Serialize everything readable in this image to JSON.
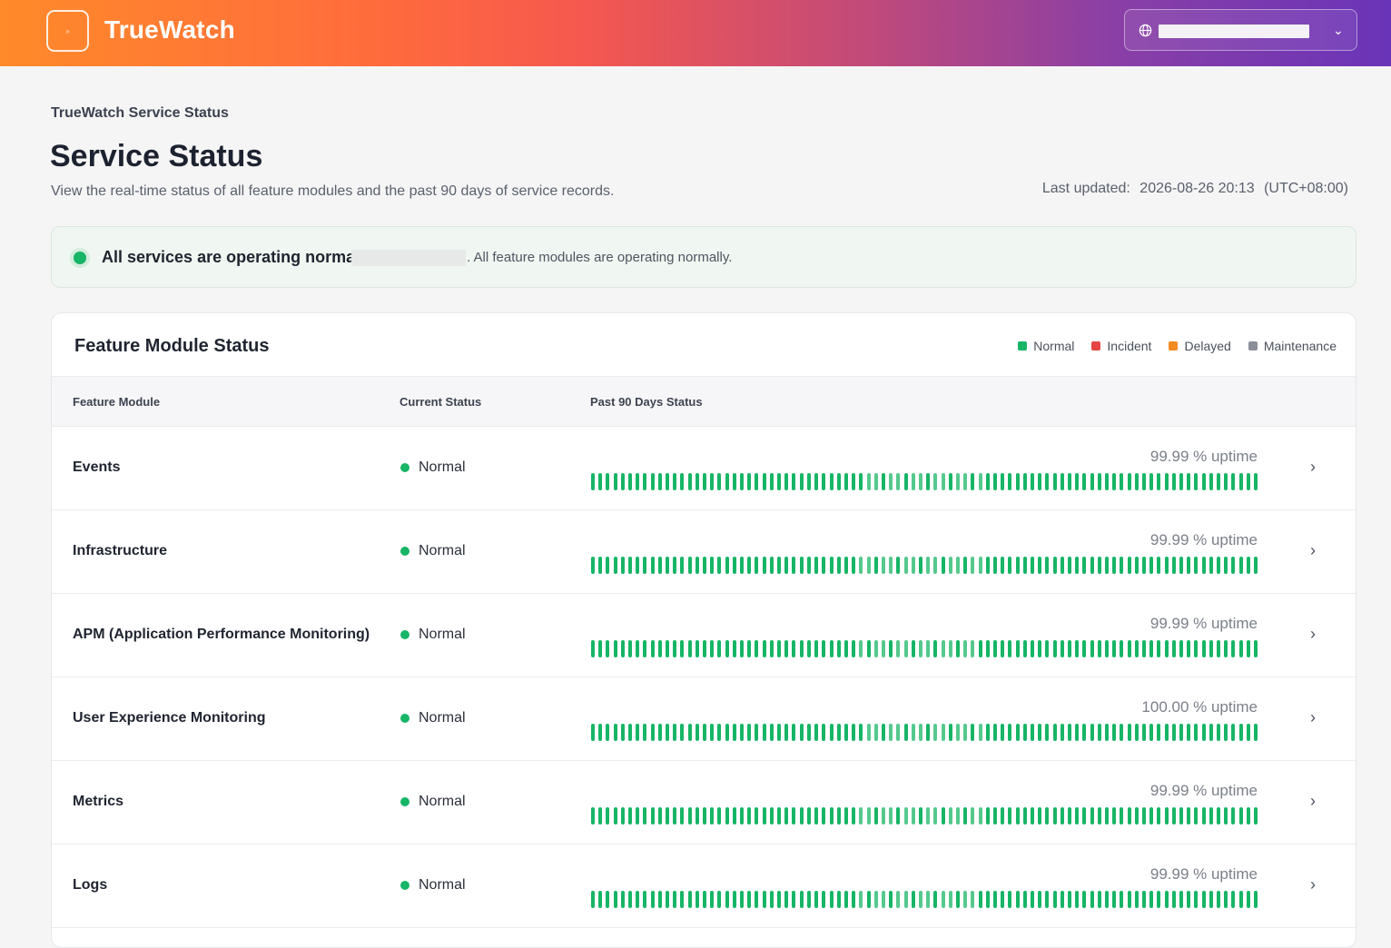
{
  "header": {
    "brand": "TrueWatch",
    "logo_glyph": "»"
  },
  "page": {
    "breadcrumb": "TrueWatch Service Status",
    "title": "Service Status",
    "subtitle": "View the real-time status of all feature modules and the past 90 days of service records.",
    "last_updated_label": "Last updated:",
    "last_updated_time": "2026-08-26 20:13",
    "timezone": "(UTC+08:00)"
  },
  "banner": {
    "headline": "All services are operating normally",
    "detail": ". All feature modules are operating normally."
  },
  "card": {
    "title": "Feature Module Status",
    "legend": [
      {
        "label": "Normal",
        "color": "#17b566"
      },
      {
        "label": "Incident",
        "color": "#e64545"
      },
      {
        "label": "Delayed",
        "color": "#f28a22"
      },
      {
        "label": "Maintenance",
        "color": "#8a8f98"
      }
    ],
    "columns": {
      "module": "Feature Module",
      "current": "Current Status",
      "history": "Past 90 Days Status"
    },
    "rows": [
      {
        "name": "Events",
        "status": "Normal",
        "uptime": "99.99 % uptime"
      },
      {
        "name": "Infrastructure",
        "status": "Normal",
        "uptime": "99.99 % uptime"
      },
      {
        "name": "APM (Application Performance Monitoring)",
        "status": "Normal",
        "uptime": "99.99 % uptime"
      },
      {
        "name": "User Experience Monitoring",
        "status": "Normal",
        "uptime": "100.00 % uptime"
      },
      {
        "name": "Metrics",
        "status": "Normal",
        "uptime": "99.99 % uptime"
      },
      {
        "name": "Logs",
        "status": "Normal",
        "uptime": "99.99 % uptime"
      }
    ],
    "days": 90,
    "colors": {
      "normal": "#17b566"
    }
  }
}
